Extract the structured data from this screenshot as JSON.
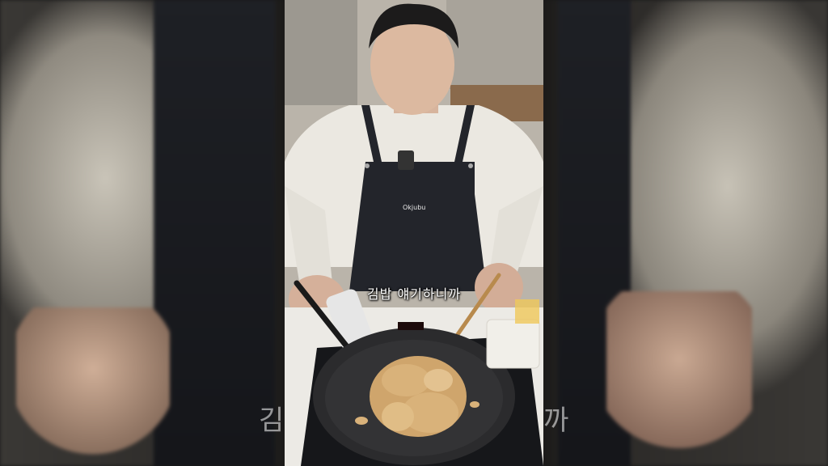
{
  "caption": "김밥 얘기하니까",
  "apron_logo": "Okjubu",
  "stove_display": "",
  "colors": {
    "shirt": "#e9e6df",
    "apron": "#23252b",
    "pan": "#2b2b2d",
    "noodles": "#d9b27a",
    "counter": "#eceae5"
  }
}
